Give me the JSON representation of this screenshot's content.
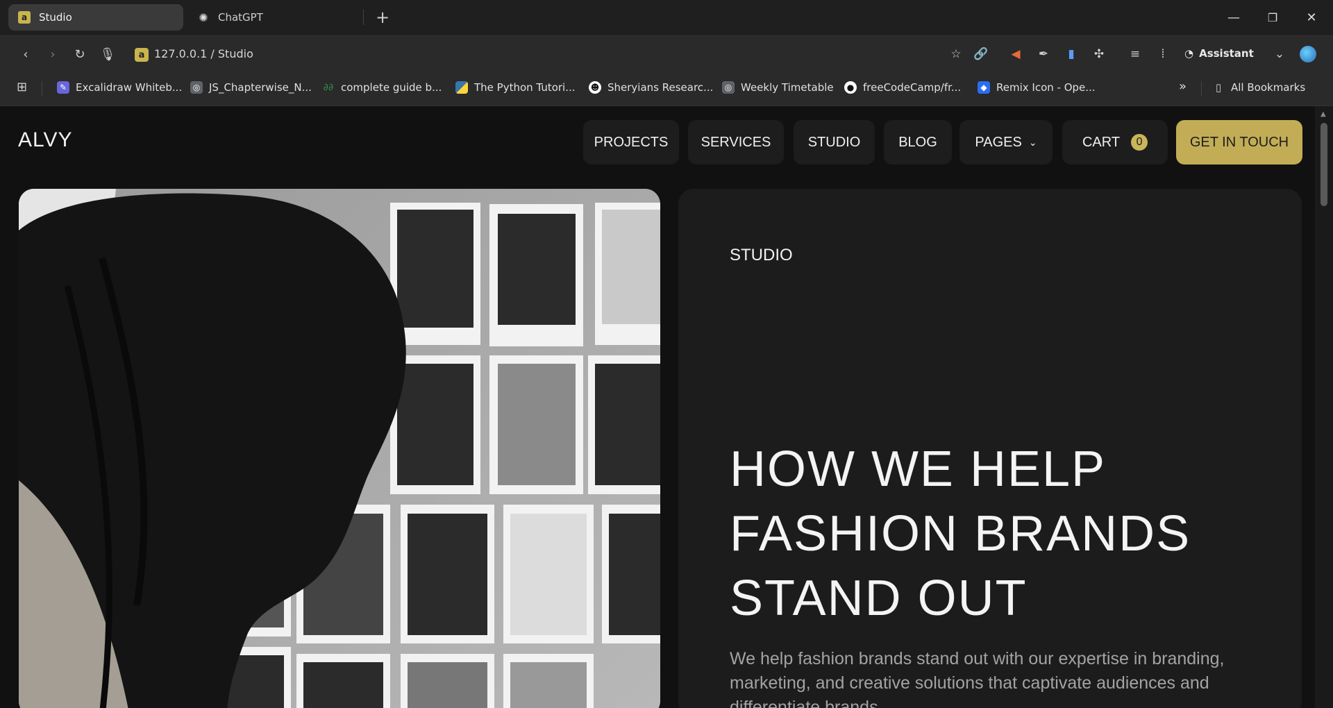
{
  "browser": {
    "tabs": [
      {
        "title": "Studio",
        "favicon": "a",
        "active": true
      },
      {
        "title": "ChatGPT",
        "favicon": "chatgpt-icon",
        "active": false
      }
    ],
    "url": "127.0.0.1 / Studio",
    "url_favicon": "a",
    "assistant_label": "Assistant",
    "bookmarks": [
      {
        "label": "Excalidraw Whiteb...",
        "icon": "excalidraw-icon",
        "color": "#6965db"
      },
      {
        "label": "JS_Chapterwise_N...",
        "icon": "globe-icon",
        "color": "#5f6368"
      },
      {
        "label": "complete guide b...",
        "icon": "geeksforgeeks-icon",
        "color": "#2f8d46"
      },
      {
        "label": "The Python Tutori...",
        "icon": "python-icon",
        "color": "#3776ab"
      },
      {
        "label": "Sheryians Researc...",
        "icon": "sheryians-icon",
        "color": "#222222"
      },
      {
        "label": "Weekly Timetable",
        "icon": "globe-icon",
        "color": "#5f6368"
      },
      {
        "label": "freeCodeCamp/fr...",
        "icon": "github-icon",
        "color": "#222222"
      },
      {
        "label": "Remix Icon - Ope...",
        "icon": "remix-icon",
        "color": "#2b6ef5"
      }
    ],
    "all_bookmarks": "All Bookmarks"
  },
  "site": {
    "logo": "ALVY",
    "nav": {
      "projects": "PROJECTS",
      "services": "SERVICES",
      "studio": "STUDIO",
      "blog": "BLOG",
      "pages": "PAGES",
      "cart": "CART",
      "cart_count": "0",
      "cta": "GET IN TOUCH"
    },
    "hero": {
      "label": "STUDIO",
      "title": "HOW WE HELP FASHION BRANDS STAND OUT",
      "description": "We help fashion brands stand out with our expertise in branding, marketing, and creative solutions that captivate audiences and differentiate brands."
    }
  },
  "colors": {
    "accent": "#c2ad56",
    "background": "#111111",
    "card": "#1c1c1c"
  }
}
